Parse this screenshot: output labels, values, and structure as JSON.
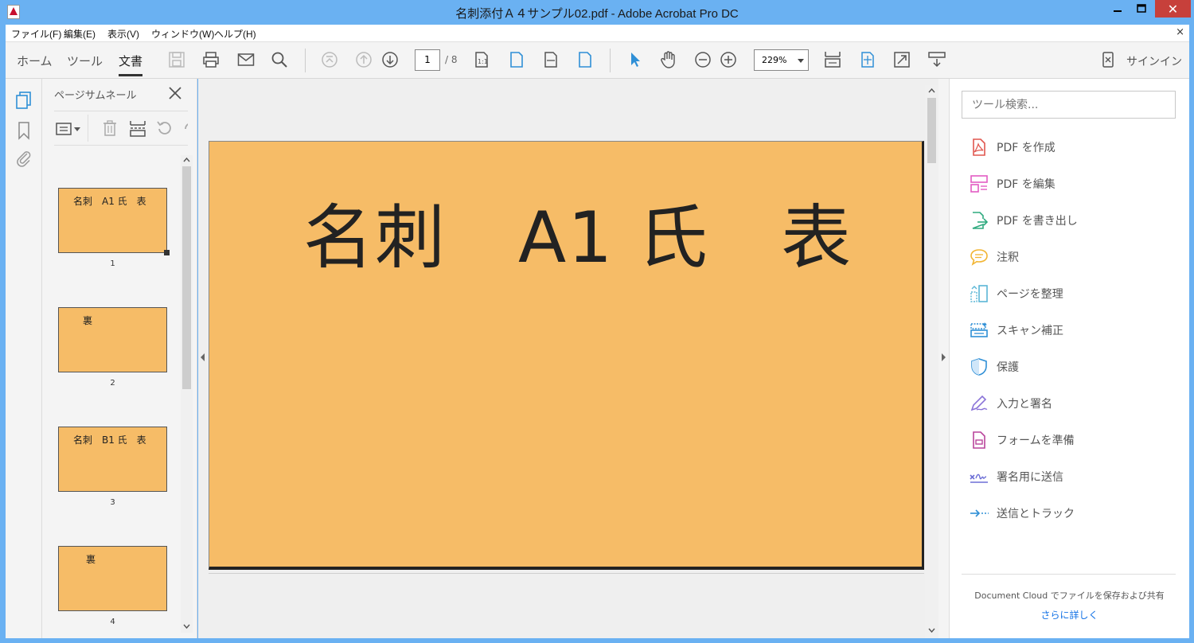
{
  "window": {
    "title": "名刺添付Ａ４サンプル02.pdf - Adobe Acrobat Pro DC",
    "close_glyph": "✕",
    "menu_close_glyph": "×"
  },
  "menu": {
    "items": [
      "ファイル(F)",
      "編集(E)",
      "表示(V)",
      "ウィンドウ(W)",
      "ヘルプ(H)"
    ]
  },
  "toolbar": {
    "tabs": [
      "ホーム",
      "ツール",
      "文書"
    ],
    "active_tab": "文書",
    "page_current": "1",
    "page_total": "/ 8",
    "zoom": "229%",
    "signin": "サインイン"
  },
  "thumbnail_panel": {
    "title": "ページサムネール",
    "pages": [
      {
        "text": "名刺　A1 氏　表",
        "number": "1"
      },
      {
        "text": "裏",
        "number": "2"
      },
      {
        "text": "名刺　B1 氏　表",
        "number": "3"
      },
      {
        "text": "裏",
        "number": "4"
      }
    ]
  },
  "document": {
    "heading": "名刺　A1 氏　表",
    "page_color": "#f6bc67"
  },
  "tools_pane": {
    "search_placeholder": "ツール検索...",
    "items": [
      {
        "label": "PDF を作成",
        "icon": "create-pdf-icon",
        "color": "#e0574f"
      },
      {
        "label": "PDF を編集",
        "icon": "edit-pdf-icon",
        "color": "#e35cc3"
      },
      {
        "label": "PDF を書き出し",
        "icon": "export-pdf-icon",
        "color": "#2faa7f"
      },
      {
        "label": "注釈",
        "icon": "comment-icon",
        "color": "#f2b533"
      },
      {
        "label": "ページを整理",
        "icon": "organize-pages-icon",
        "color": "#5ab6d6"
      },
      {
        "label": "スキャン補正",
        "icon": "scan-icon",
        "color": "#2f8fd6"
      },
      {
        "label": "保護",
        "icon": "protect-icon",
        "color": "#2f8fd6"
      },
      {
        "label": "入力と署名",
        "icon": "fill-sign-icon",
        "color": "#8a73d8"
      },
      {
        "label": "フォームを準備",
        "icon": "prepare-form-icon",
        "color": "#b9449b"
      },
      {
        "label": "署名用に送信",
        "icon": "send-sign-icon",
        "color": "#6d6fd6"
      },
      {
        "label": "送信とトラック",
        "icon": "send-track-icon",
        "color": "#2f8fd6"
      }
    ],
    "cloud_text": "Document Cloud でファイルを保存および共有",
    "cloud_link": "さらに詳しく"
  }
}
